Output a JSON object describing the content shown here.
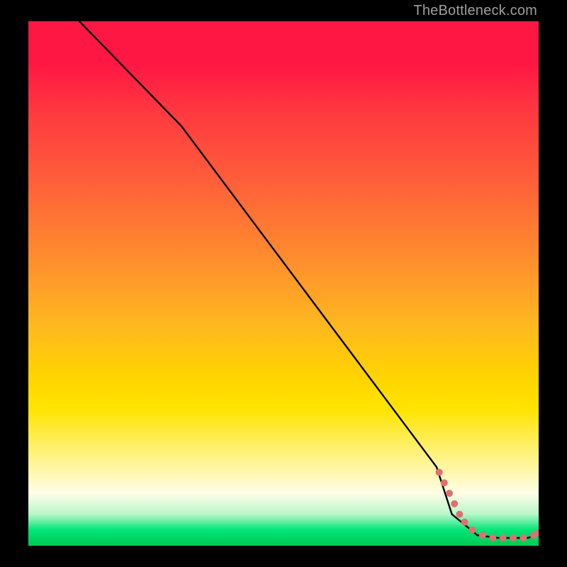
{
  "attribution": "TheBottleneck.com",
  "chart_data": {
    "type": "line",
    "title": "",
    "xlabel": "",
    "ylabel": "",
    "xlim": [
      0,
      100
    ],
    "ylim": [
      0,
      100
    ],
    "grid": false,
    "legend": false,
    "series": [
      {
        "name": "curve",
        "x": [
          10,
          20,
          30,
          40,
          50,
          60,
          70,
          80,
          83,
          88,
          92,
          95,
          98,
          100
        ],
        "y": [
          100,
          90,
          80,
          67,
          54,
          41,
          28,
          15,
          6,
          2,
          1.5,
          1.5,
          1.5,
          2.5
        ]
      }
    ],
    "markers": {
      "name": "highlight-dots",
      "color": "#e07070",
      "points": [
        {
          "x": 80.5,
          "y": 14
        },
        {
          "x": 81.5,
          "y": 12
        },
        {
          "x": 82.5,
          "y": 10
        },
        {
          "x": 83.5,
          "y": 8
        },
        {
          "x": 84.5,
          "y": 6
        },
        {
          "x": 85.5,
          "y": 4.5
        },
        {
          "x": 87,
          "y": 3
        },
        {
          "x": 89,
          "y": 2
        },
        {
          "x": 91,
          "y": 1.5
        },
        {
          "x": 93,
          "y": 1.5
        },
        {
          "x": 95,
          "y": 1.5
        },
        {
          "x": 97,
          "y": 1.5
        },
        {
          "x": 99,
          "y": 2
        },
        {
          "x": 100,
          "y": 2.5
        }
      ]
    }
  }
}
